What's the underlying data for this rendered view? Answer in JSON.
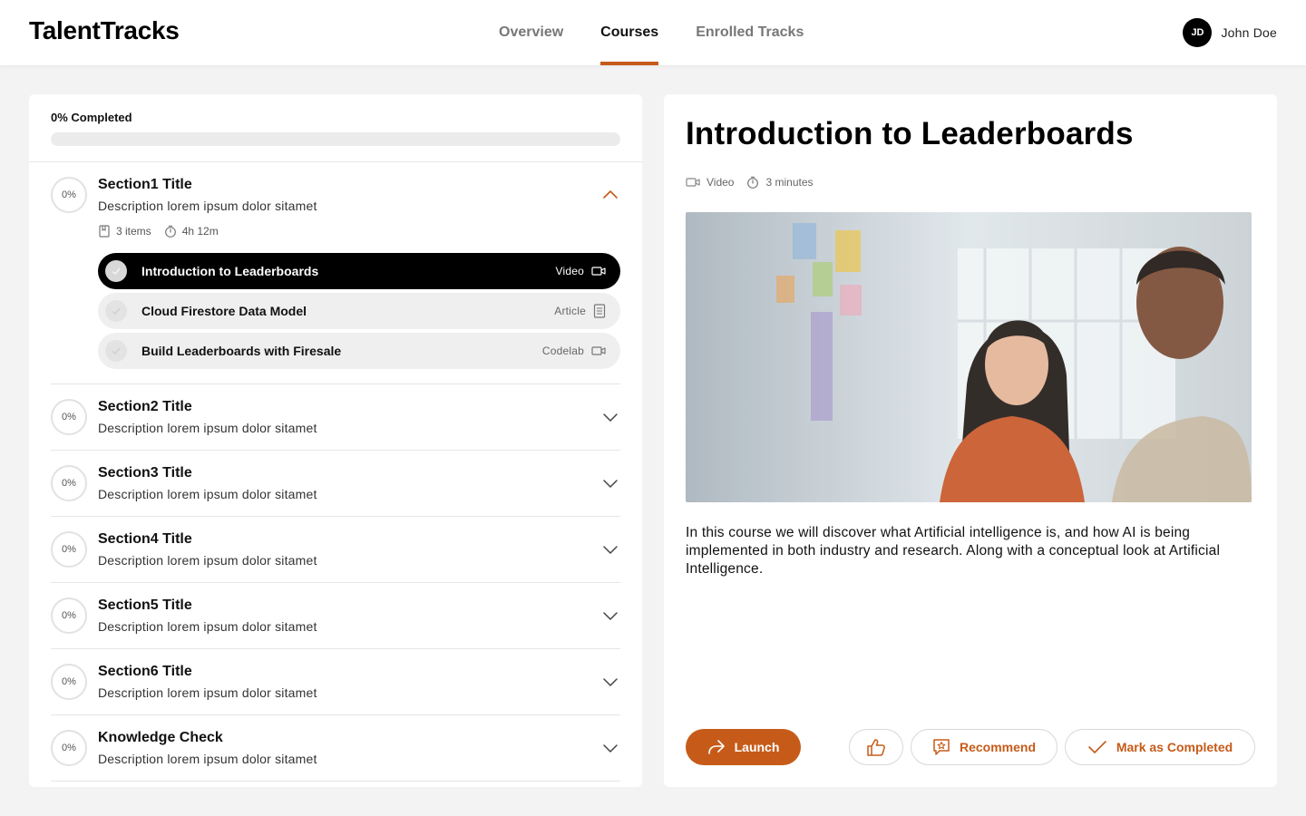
{
  "app": {
    "brand": "TalentTracks"
  },
  "nav": {
    "items": [
      {
        "label": "Overview",
        "active": false
      },
      {
        "label": "Courses",
        "active": true
      },
      {
        "label": "Enrolled Tracks",
        "active": false
      }
    ]
  },
  "user": {
    "initials": "JD",
    "name": "John Doe"
  },
  "progress": {
    "label": "0% Completed",
    "value": 0
  },
  "sections": [
    {
      "progress": "0%",
      "title": "Section1 Title",
      "description": "Description lorem ipsum dolor sitamet",
      "expanded": true,
      "meta": {
        "items": "3 items",
        "duration": "4h 12m"
      },
      "items": [
        {
          "title": "Introduction to Leaderboards",
          "type": "Video",
          "icon": "video-icon",
          "active": true
        },
        {
          "title": "Cloud Firestore Data Model",
          "type": "Article",
          "icon": "article-icon",
          "active": false
        },
        {
          "title": "Build Leaderboards with Firesale",
          "type": "Codelab",
          "icon": "video-icon",
          "active": false
        }
      ]
    },
    {
      "progress": "0%",
      "title": "Section2 Title",
      "description": "Description lorem ipsum dolor sitamet",
      "expanded": false
    },
    {
      "progress": "0%",
      "title": "Section3 Title",
      "description": "Description lorem ipsum dolor sitamet",
      "expanded": false
    },
    {
      "progress": "0%",
      "title": "Section4 Title",
      "description": "Description lorem ipsum dolor sitamet",
      "expanded": false
    },
    {
      "progress": "0%",
      "title": "Section5 Title",
      "description": "Description lorem ipsum dolor sitamet",
      "expanded": false
    },
    {
      "progress": "0%",
      "title": "Section6 Title",
      "description": "Description lorem ipsum dolor sitamet",
      "expanded": false
    },
    {
      "progress": "0%",
      "title": "Knowledge Check",
      "description": "Description lorem ipsum dolor sitamet",
      "expanded": false
    }
  ],
  "course": {
    "title": "Introduction to Leaderboards",
    "type": "Video",
    "duration": "3 minutes",
    "description": "In this course we will discover what Artificial intelligence is, and how AI is being implemented in both industry and research. Along with a conceptual look at Artificial Intelligence.",
    "actions": {
      "launch": "Launch",
      "recommend": "Recommend",
      "complete": "Mark as Completed"
    }
  },
  "colors": {
    "accent": "#c65b19",
    "active_item": "#000000",
    "background": "#f3f3f3"
  }
}
